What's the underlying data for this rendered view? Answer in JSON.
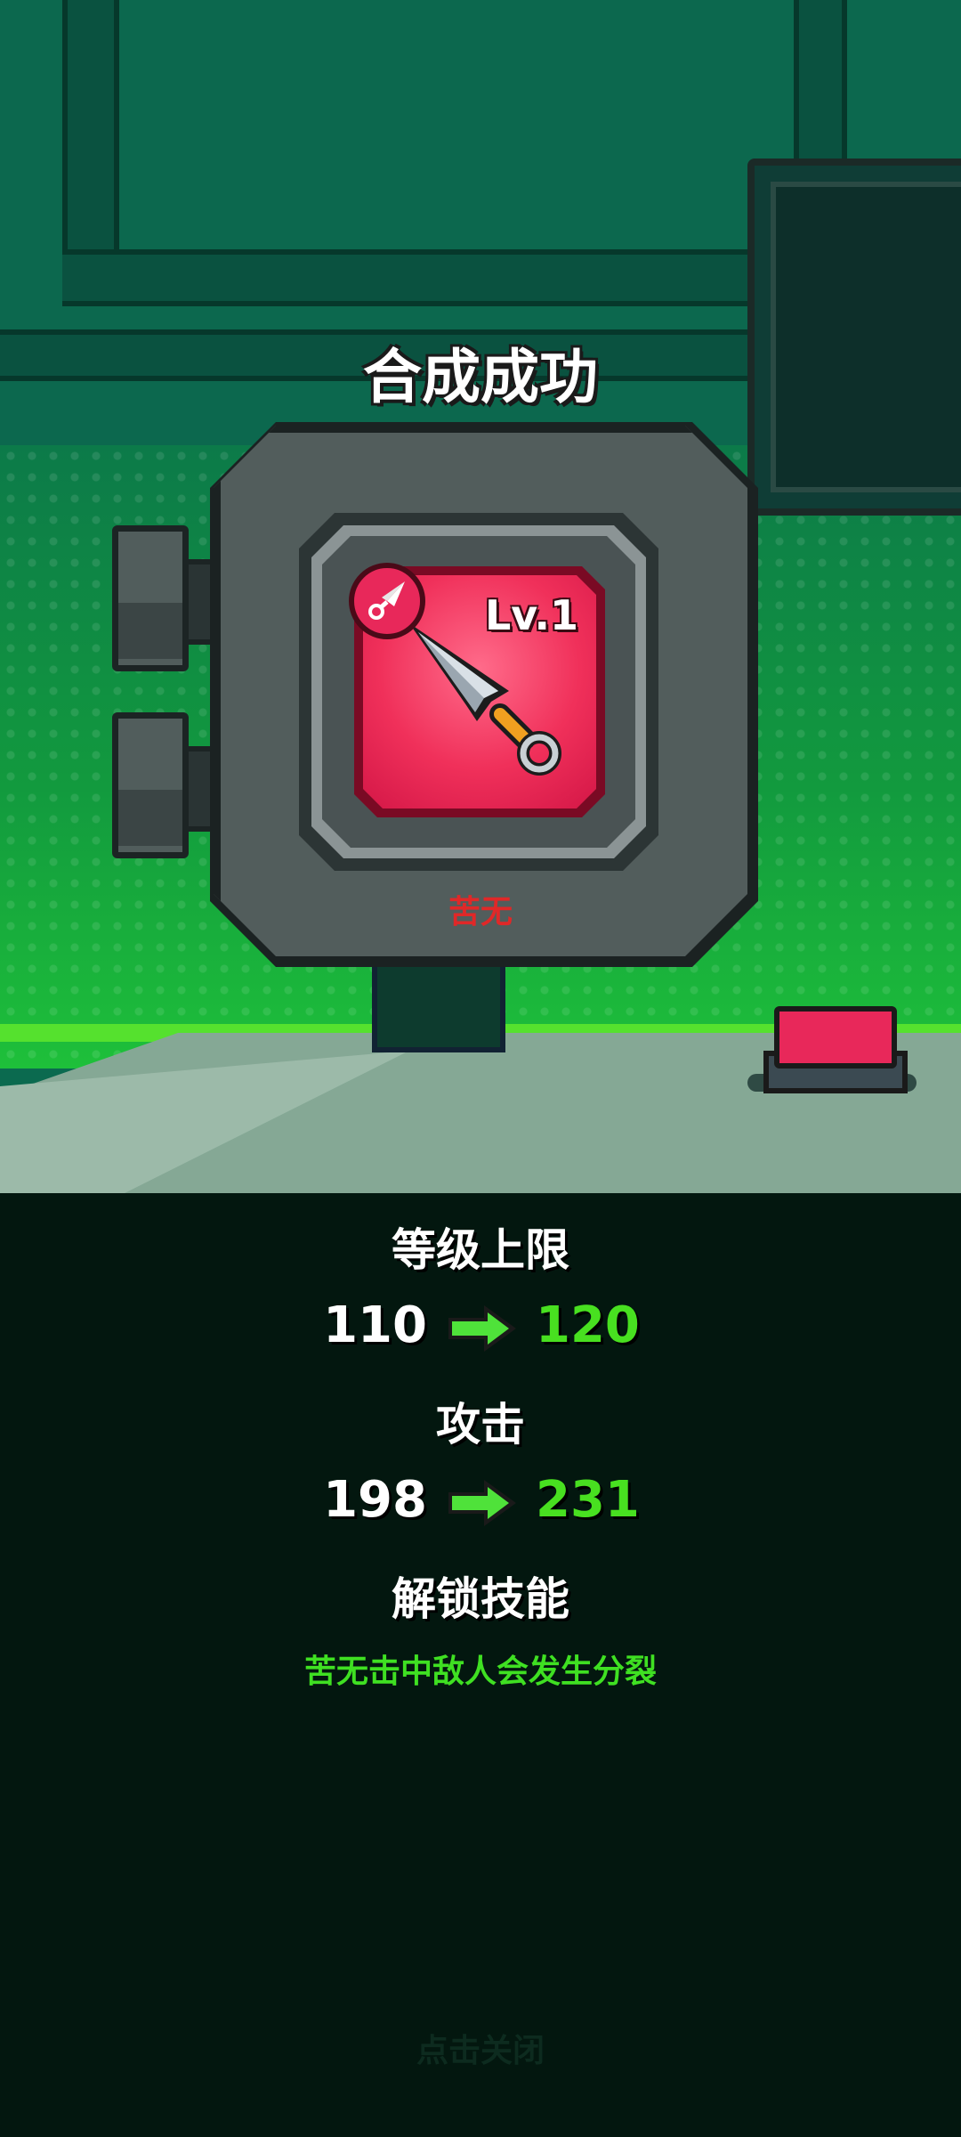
{
  "popup": {
    "title": "合成成功",
    "item": {
      "name": "苦无",
      "level": "Lv.1",
      "icon": "kunai-icon",
      "badge_icon": "kunai-badge-icon",
      "card_color": "#f0305a"
    },
    "stats": [
      {
        "label": "等级上限",
        "old": "110",
        "new": "120"
      },
      {
        "label": "攻击",
        "old": "198",
        "new": "231"
      }
    ],
    "skill": {
      "label": "解锁技能",
      "description": "苦无击中敌人会发生分裂"
    },
    "close_hint": "点击关闭"
  },
  "colors": {
    "accent_green": "#48e020",
    "item_name_red": "#e02828",
    "panel_bg": "#03170f"
  }
}
